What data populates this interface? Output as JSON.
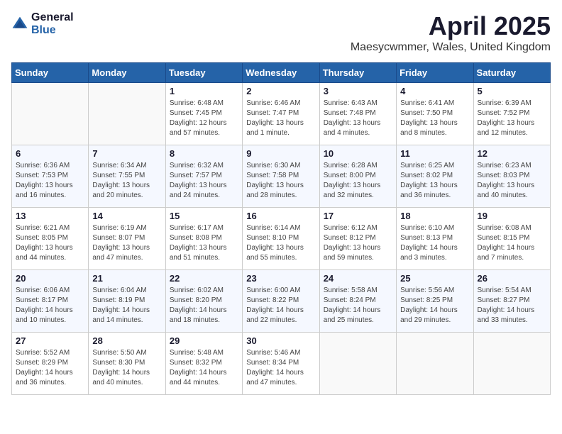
{
  "logo": {
    "general": "General",
    "blue": "Blue"
  },
  "title": "April 2025",
  "location": "Maesycwmmer, Wales, United Kingdom",
  "weekdays": [
    "Sunday",
    "Monday",
    "Tuesday",
    "Wednesday",
    "Thursday",
    "Friday",
    "Saturday"
  ],
  "weeks": [
    [
      {
        "day": "",
        "info": ""
      },
      {
        "day": "",
        "info": ""
      },
      {
        "day": "1",
        "info": "Sunrise: 6:48 AM\nSunset: 7:45 PM\nDaylight: 12 hours and 57 minutes."
      },
      {
        "day": "2",
        "info": "Sunrise: 6:46 AM\nSunset: 7:47 PM\nDaylight: 13 hours and 1 minute."
      },
      {
        "day": "3",
        "info": "Sunrise: 6:43 AM\nSunset: 7:48 PM\nDaylight: 13 hours and 4 minutes."
      },
      {
        "day": "4",
        "info": "Sunrise: 6:41 AM\nSunset: 7:50 PM\nDaylight: 13 hours and 8 minutes."
      },
      {
        "day": "5",
        "info": "Sunrise: 6:39 AM\nSunset: 7:52 PM\nDaylight: 13 hours and 12 minutes."
      }
    ],
    [
      {
        "day": "6",
        "info": "Sunrise: 6:36 AM\nSunset: 7:53 PM\nDaylight: 13 hours and 16 minutes."
      },
      {
        "day": "7",
        "info": "Sunrise: 6:34 AM\nSunset: 7:55 PM\nDaylight: 13 hours and 20 minutes."
      },
      {
        "day": "8",
        "info": "Sunrise: 6:32 AM\nSunset: 7:57 PM\nDaylight: 13 hours and 24 minutes."
      },
      {
        "day": "9",
        "info": "Sunrise: 6:30 AM\nSunset: 7:58 PM\nDaylight: 13 hours and 28 minutes."
      },
      {
        "day": "10",
        "info": "Sunrise: 6:28 AM\nSunset: 8:00 PM\nDaylight: 13 hours and 32 minutes."
      },
      {
        "day": "11",
        "info": "Sunrise: 6:25 AM\nSunset: 8:02 PM\nDaylight: 13 hours and 36 minutes."
      },
      {
        "day": "12",
        "info": "Sunrise: 6:23 AM\nSunset: 8:03 PM\nDaylight: 13 hours and 40 minutes."
      }
    ],
    [
      {
        "day": "13",
        "info": "Sunrise: 6:21 AM\nSunset: 8:05 PM\nDaylight: 13 hours and 44 minutes."
      },
      {
        "day": "14",
        "info": "Sunrise: 6:19 AM\nSunset: 8:07 PM\nDaylight: 13 hours and 47 minutes."
      },
      {
        "day": "15",
        "info": "Sunrise: 6:17 AM\nSunset: 8:08 PM\nDaylight: 13 hours and 51 minutes."
      },
      {
        "day": "16",
        "info": "Sunrise: 6:14 AM\nSunset: 8:10 PM\nDaylight: 13 hours and 55 minutes."
      },
      {
        "day": "17",
        "info": "Sunrise: 6:12 AM\nSunset: 8:12 PM\nDaylight: 13 hours and 59 minutes."
      },
      {
        "day": "18",
        "info": "Sunrise: 6:10 AM\nSunset: 8:13 PM\nDaylight: 14 hours and 3 minutes."
      },
      {
        "day": "19",
        "info": "Sunrise: 6:08 AM\nSunset: 8:15 PM\nDaylight: 14 hours and 7 minutes."
      }
    ],
    [
      {
        "day": "20",
        "info": "Sunrise: 6:06 AM\nSunset: 8:17 PM\nDaylight: 14 hours and 10 minutes."
      },
      {
        "day": "21",
        "info": "Sunrise: 6:04 AM\nSunset: 8:19 PM\nDaylight: 14 hours and 14 minutes."
      },
      {
        "day": "22",
        "info": "Sunrise: 6:02 AM\nSunset: 8:20 PM\nDaylight: 14 hours and 18 minutes."
      },
      {
        "day": "23",
        "info": "Sunrise: 6:00 AM\nSunset: 8:22 PM\nDaylight: 14 hours and 22 minutes."
      },
      {
        "day": "24",
        "info": "Sunrise: 5:58 AM\nSunset: 8:24 PM\nDaylight: 14 hours and 25 minutes."
      },
      {
        "day": "25",
        "info": "Sunrise: 5:56 AM\nSunset: 8:25 PM\nDaylight: 14 hours and 29 minutes."
      },
      {
        "day": "26",
        "info": "Sunrise: 5:54 AM\nSunset: 8:27 PM\nDaylight: 14 hours and 33 minutes."
      }
    ],
    [
      {
        "day": "27",
        "info": "Sunrise: 5:52 AM\nSunset: 8:29 PM\nDaylight: 14 hours and 36 minutes."
      },
      {
        "day": "28",
        "info": "Sunrise: 5:50 AM\nSunset: 8:30 PM\nDaylight: 14 hours and 40 minutes."
      },
      {
        "day": "29",
        "info": "Sunrise: 5:48 AM\nSunset: 8:32 PM\nDaylight: 14 hours and 44 minutes."
      },
      {
        "day": "30",
        "info": "Sunrise: 5:46 AM\nSunset: 8:34 PM\nDaylight: 14 hours and 47 minutes."
      },
      {
        "day": "",
        "info": ""
      },
      {
        "day": "",
        "info": ""
      },
      {
        "day": "",
        "info": ""
      }
    ]
  ]
}
